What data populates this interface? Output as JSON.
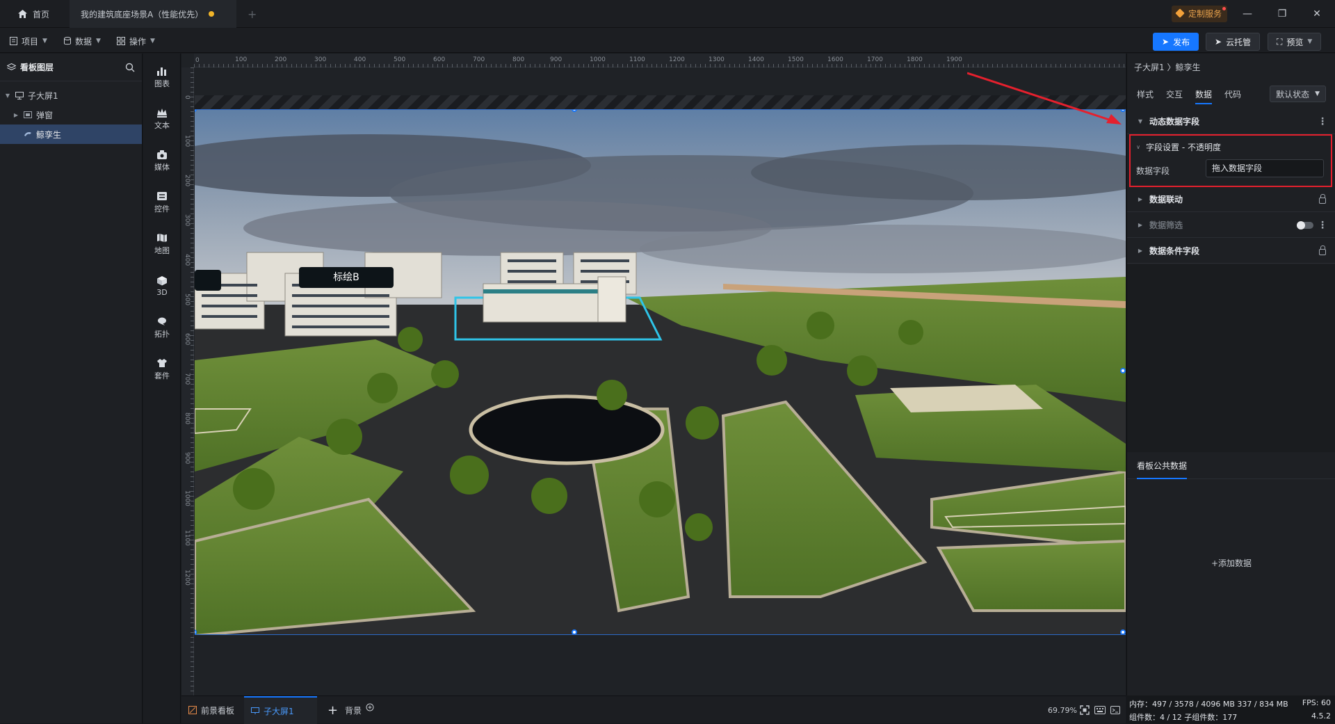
{
  "titlebar": {
    "home_tab": "首页",
    "project_tab": "我的建筑底座场景A（性能优先）",
    "new_tab": "+",
    "custom_service": "定制服务",
    "minimize": "—",
    "restore": "❐",
    "close": "✕"
  },
  "menubar": {
    "items": [
      {
        "label": "项目"
      },
      {
        "label": "数据"
      },
      {
        "label": "操作"
      }
    ],
    "publish": "发布",
    "cloud_host": "云托管",
    "preview": "预览"
  },
  "layers": {
    "title": "看板图层",
    "tree": [
      {
        "label": "子大屏1"
      },
      {
        "label": "弹窗"
      },
      {
        "label": "鲸孪生"
      }
    ]
  },
  "components": [
    {
      "label": "图表",
      "icon": "chart-icon"
    },
    {
      "label": "文本",
      "icon": "text-icon"
    },
    {
      "label": "媒体",
      "icon": "media-icon"
    },
    {
      "label": "控件",
      "icon": "widget-icon"
    },
    {
      "label": "地图",
      "icon": "map-icon"
    },
    {
      "label": "3D",
      "icon": "cube-icon"
    },
    {
      "label": "拓扑",
      "icon": "topology-icon"
    },
    {
      "label": "套件",
      "icon": "kit-icon"
    }
  ],
  "rulers": {
    "top": [
      "100",
      "200",
      "300",
      "400",
      "500",
      "600",
      "700",
      "800",
      "900",
      "1000",
      "1100",
      "1200",
      "1300",
      "1400",
      "1500",
      "1600",
      "1700",
      "1800",
      "1900"
    ],
    "left": [
      "0",
      "100",
      "200",
      "300",
      "400",
      "500",
      "600",
      "700",
      "800",
      "900",
      "1000",
      "1100",
      "1200"
    ]
  },
  "scene": {
    "marker_label": "标绘B"
  },
  "bottom": {
    "tabs": [
      {
        "label": "前景看板"
      },
      {
        "label": "子大屏1"
      }
    ],
    "add": "+",
    "background": "背景",
    "zoom": "69.79%"
  },
  "right": {
    "breadcrumb": "子大屏1 〉鲸孪生",
    "tabs": [
      "样式",
      "交互",
      "数据",
      "代码"
    ],
    "state_select": "默认状态",
    "dynamic_fields": "动态数据字段",
    "field_setting_title": "字段设置 - 不透明度",
    "data_field_label": "数据字段",
    "data_field_placeholder": "拖入数据字段",
    "data_linkage": "数据联动",
    "data_filter": "数据筛选",
    "data_condition": "数据条件字段",
    "public_data_tab": "看板公共数据",
    "add_data": "+添加数据"
  },
  "status": {
    "memory": "内存：497 / 3578 / 4096 MB  337 / 834 MB",
    "fps": "FPS: 60",
    "components": "组件数：4 / 12   子组件数：177",
    "version": "4.5.2"
  },
  "colors": {
    "accent": "#1677ff",
    "highlight_box": "#e5202d",
    "selection": "#2f4466"
  }
}
